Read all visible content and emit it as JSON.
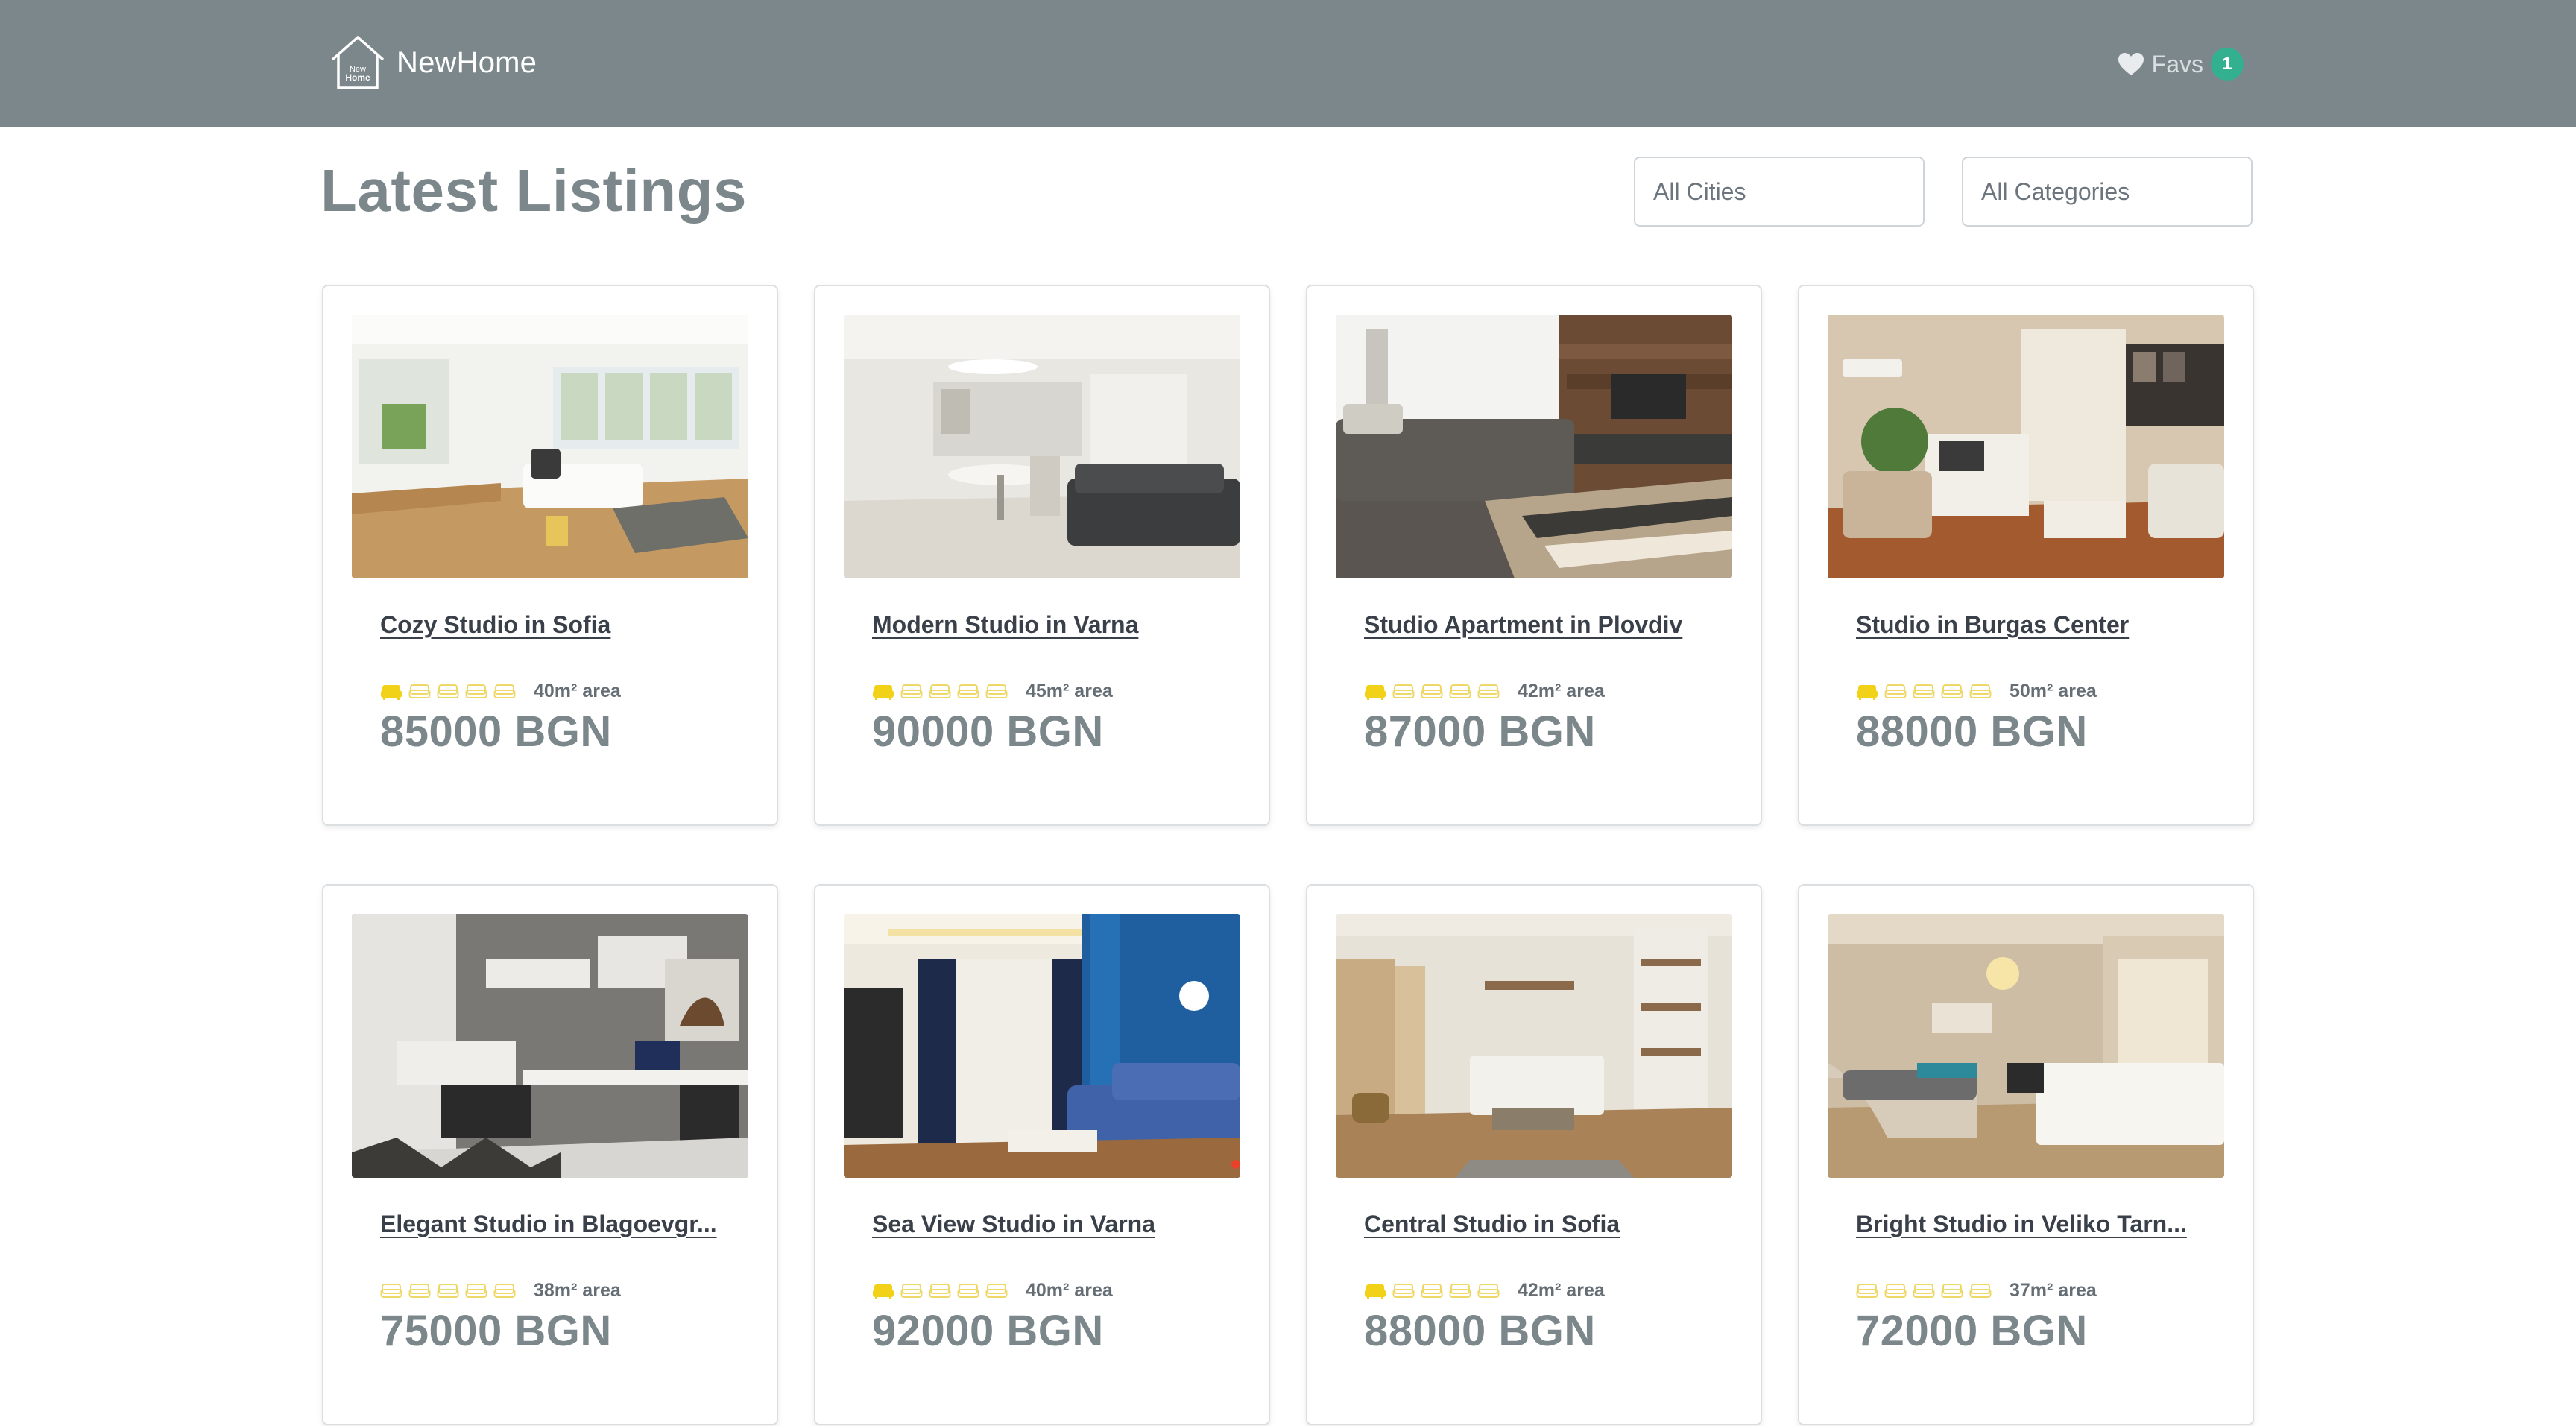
{
  "header": {
    "logo_text_top": "New",
    "logo_text_bottom": "Home",
    "brand": "NewHome",
    "favs_label": "Favs",
    "favs_count": "1"
  },
  "page": {
    "title": "Latest Listings"
  },
  "filters": {
    "city": "All Cities",
    "category": "All Categories"
  },
  "colors": {
    "header_bg": "#7b878a",
    "badge": "#33b08f",
    "star_filled": "#f2d218",
    "star_empty": "#f2e28a"
  },
  "listings": [
    {
      "title": "Cozy Studio in Sofia",
      "rating": 1,
      "area": "40m² area",
      "price": "85000 BGN",
      "image": "bright-living-room"
    },
    {
      "title": "Modern Studio in Varna",
      "rating": 1,
      "area": "45m² area",
      "price": "90000 BGN",
      "image": "white-kitchen-dining"
    },
    {
      "title": "Studio Apartment in Plovdiv",
      "rating": 1,
      "area": "42m² area",
      "price": "87000 BGN",
      "image": "sofa-wood-wall"
    },
    {
      "title": "Studio in Burgas Center",
      "rating": 1,
      "area": "50m² area",
      "price": "88000 BGN",
      "image": "warm-living-room"
    },
    {
      "title": "Elegant Studio in Blagoevgr...",
      "rating": 0,
      "area": "38m² area",
      "price": "75000 BGN",
      "image": "grey-bedroom-desk"
    },
    {
      "title": "Sea View Studio in Varna",
      "rating": 1,
      "area": "40m² area",
      "price": "92000 BGN",
      "image": "blue-wall-lounge"
    },
    {
      "title": "Central Studio in Sofia",
      "rating": 1,
      "area": "42m² area",
      "price": "88000 BGN",
      "image": "rustic-bedroom"
    },
    {
      "title": "Bright Studio in Veliko Tarn...",
      "rating": 0,
      "area": "37m² area",
      "price": "72000 BGN",
      "image": "beige-bedroom"
    }
  ]
}
